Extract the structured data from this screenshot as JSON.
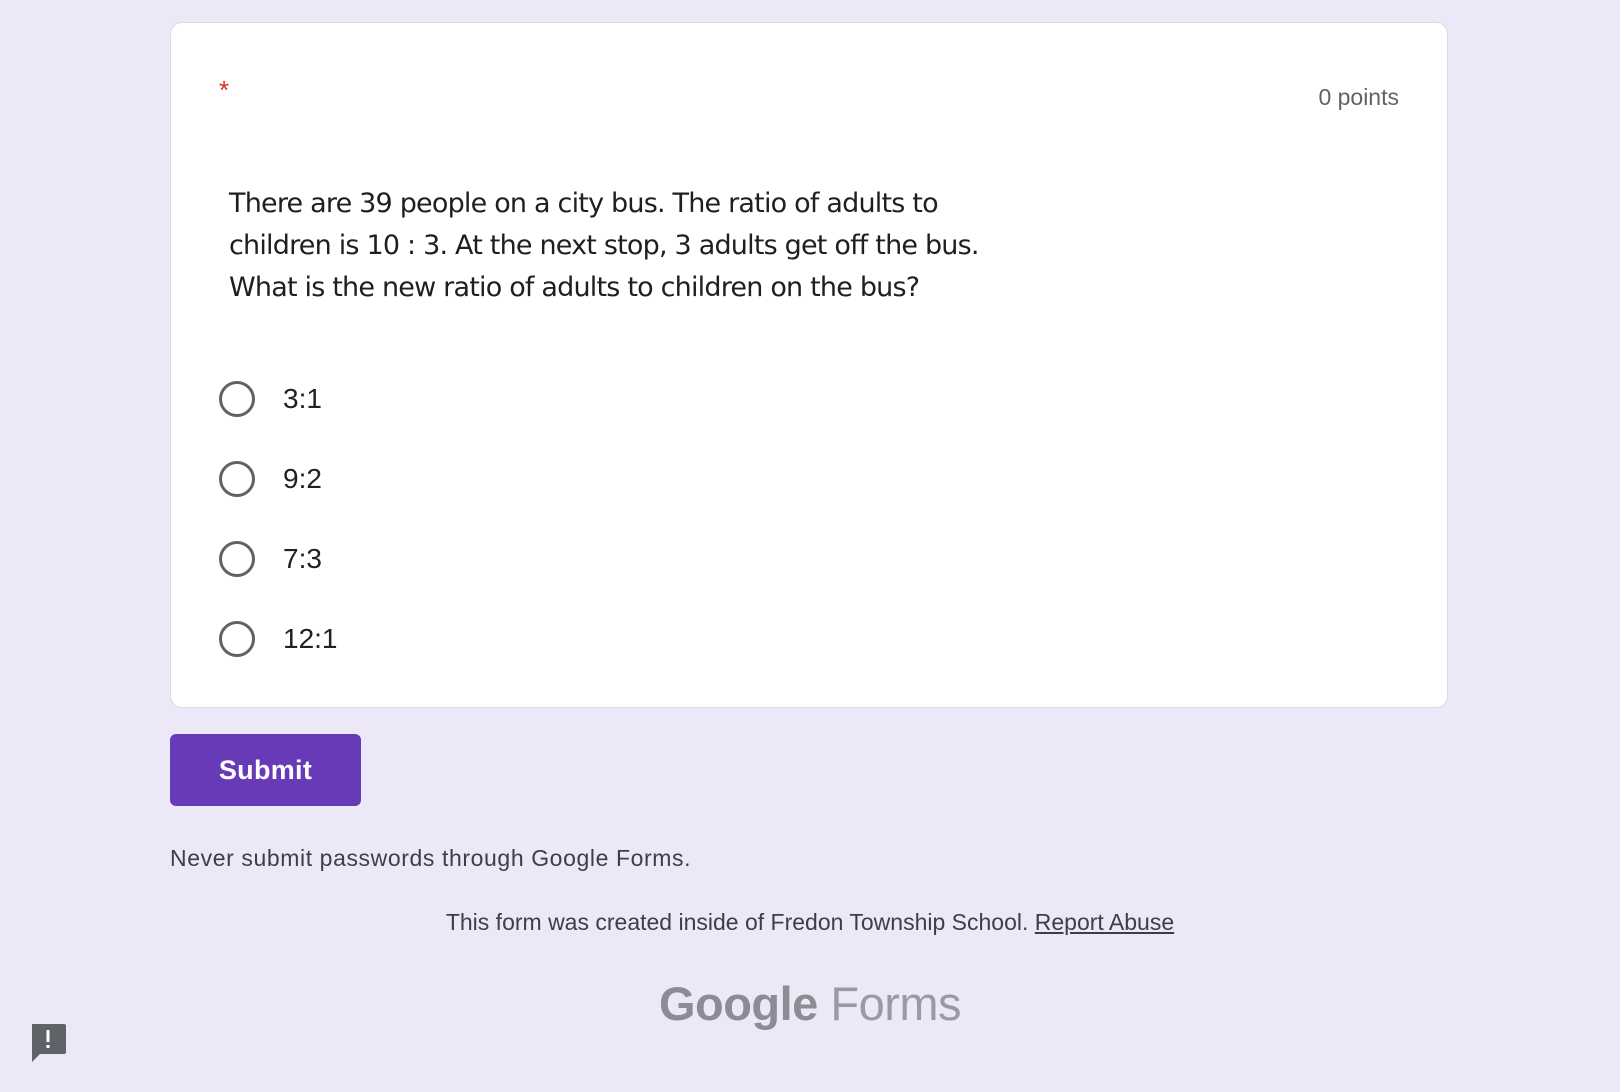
{
  "question": {
    "required_marker": "*",
    "points": "0 points",
    "image_text": [
      "There are 39 people on a city bus. The ratio of adults to",
      "children is 10 : 3. At the next stop, 3 adults get off the bus.",
      "What is the new ratio of adults to children on the bus?"
    ],
    "options": [
      {
        "label": "3:1",
        "selected": false
      },
      {
        "label": "9:2",
        "selected": false
      },
      {
        "label": "7:3",
        "selected": false
      },
      {
        "label": "12:1",
        "selected": false
      }
    ]
  },
  "form": {
    "submit_label": "Submit",
    "password_warning": "Never submit passwords through Google Forms."
  },
  "footer": {
    "created_inside": "This form was created inside of Fredon Township School.",
    "report_abuse": "Report Abuse",
    "logo_google": "Google",
    "logo_forms": "Forms"
  },
  "icons": {
    "feedback": "report-feedback-icon"
  },
  "colors": {
    "page_background": "#ede8f7",
    "accent": "#673ab7",
    "required": "#d93025"
  }
}
